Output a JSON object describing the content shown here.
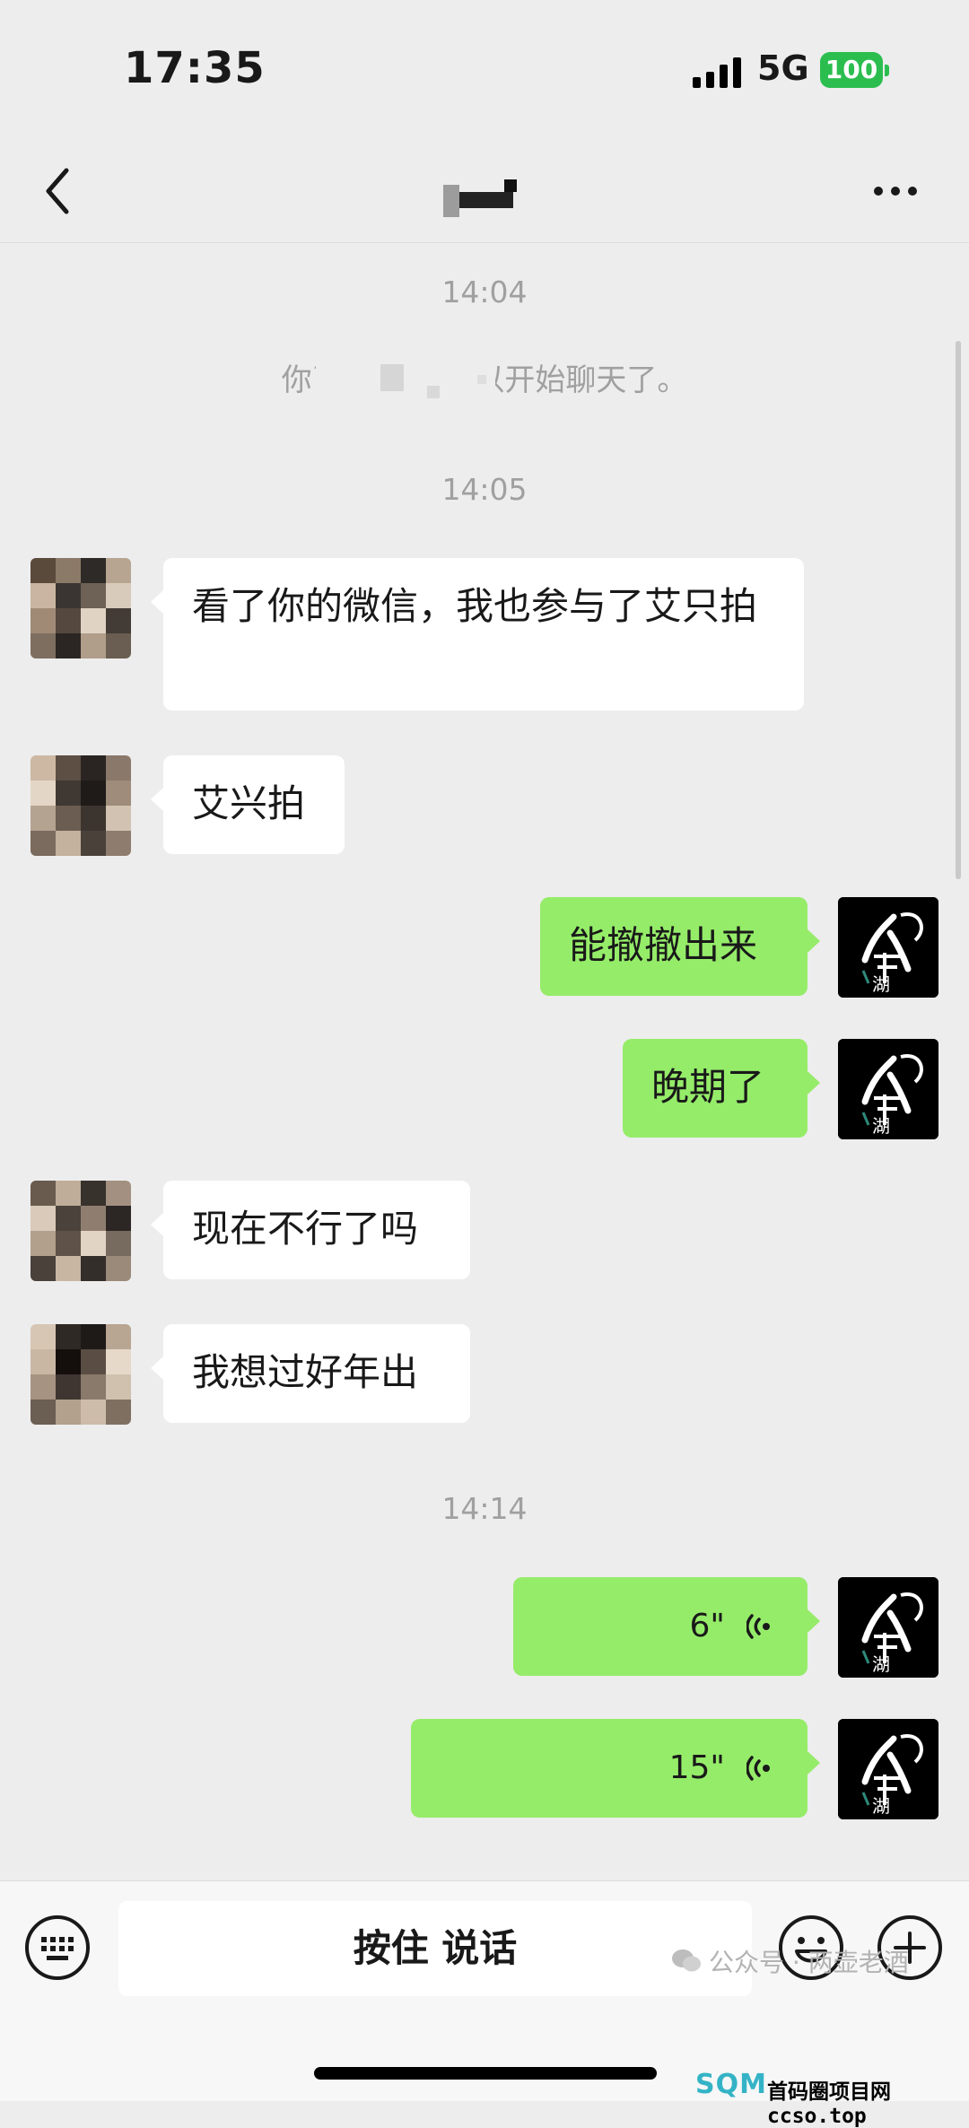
{
  "status": {
    "time": "17:35",
    "network": "5G",
    "battery": "100"
  },
  "nav": {
    "title": ""
  },
  "chat": {
    "timestamps": [
      "14:04",
      "14:05",
      "14:14"
    ],
    "system_message": "你已添加                  在可以开始聊天了。",
    "messages": [
      {
        "from": "them",
        "text": "看了你的微信，我也参与了艾只拍"
      },
      {
        "from": "them",
        "text": "艾兴拍"
      },
      {
        "from": "me",
        "text": "能撤撤出来"
      },
      {
        "from": "me",
        "text": "晚期了"
      },
      {
        "from": "them",
        "text": "现在不行了吗"
      },
      {
        "from": "them",
        "text": "我想过好年出"
      },
      {
        "from": "me",
        "type": "voice",
        "duration": "6\""
      },
      {
        "from": "me",
        "type": "voice",
        "duration": "15\""
      }
    ]
  },
  "input": {
    "hold_to_talk": "按住 说话"
  },
  "watermark": {
    "text": "公众号 · 两壶老酒",
    "site_logo": "SQM",
    "site_text": "首码圈项目网 ccso.top"
  },
  "colors": {
    "background": "#ededed",
    "incoming_bubble": "#ffffff",
    "outgoing_bubble": "#95ec69",
    "battery": "#2bbe4f"
  },
  "icons": [
    "back-chevron-icon",
    "more-icon",
    "keyboard-icon",
    "emoji-icon",
    "plus-icon",
    "voice-wave-icon",
    "wechat-icon"
  ]
}
